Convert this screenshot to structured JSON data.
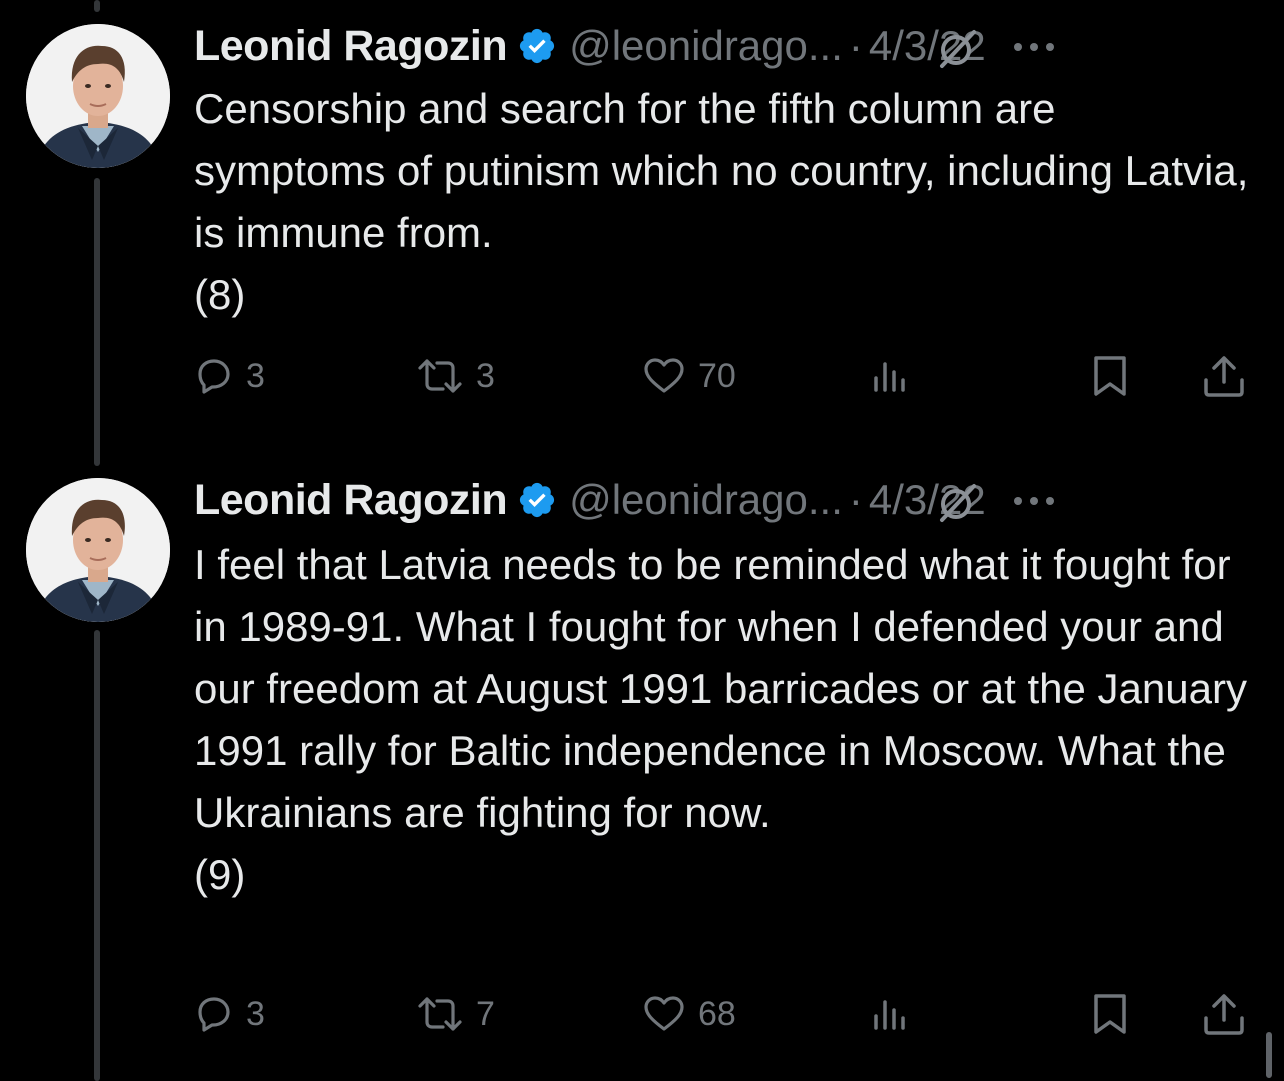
{
  "tweets": [
    {
      "author_name": "Leonid Ragozin",
      "handle": "@leonidrago...",
      "separator": "·",
      "date": "4/3/22",
      "text_lines": [
        "Censorship and search for the fifth column are symptoms of putinism which no country, including Latvia, is immune from.",
        "(8)"
      ],
      "reply_count": "3",
      "retweet_count": "3",
      "like_count": "70"
    },
    {
      "author_name": "Leonid Ragozin",
      "handle": "@leonidrago...",
      "separator": "·",
      "date": "4/3/22",
      "text_lines": [
        "I feel that Latvia needs to be reminded what it fought for in 1989-91. What I fought for when I defended your and our freedom at August 1991 barricades or at the January 1991 rally for Baltic independence in Moscow. What the Ukrainians are fighting for now.",
        "(9)"
      ],
      "reply_count": "3",
      "retweet_count": "7",
      "like_count": "68"
    }
  ],
  "icons": {
    "verified": "verified-badge-icon",
    "grok": "grok-icon",
    "more": "more-icon",
    "reply": "reply-icon",
    "retweet": "retweet-icon",
    "like": "like-icon",
    "views": "views-icon",
    "bookmark": "bookmark-icon",
    "share": "share-icon"
  },
  "colors": {
    "background": "#000000",
    "text_primary": "#e7e9ea",
    "text_secondary": "#71767b",
    "verified_blue": "#1d9bf0",
    "thread_line": "#333639"
  }
}
